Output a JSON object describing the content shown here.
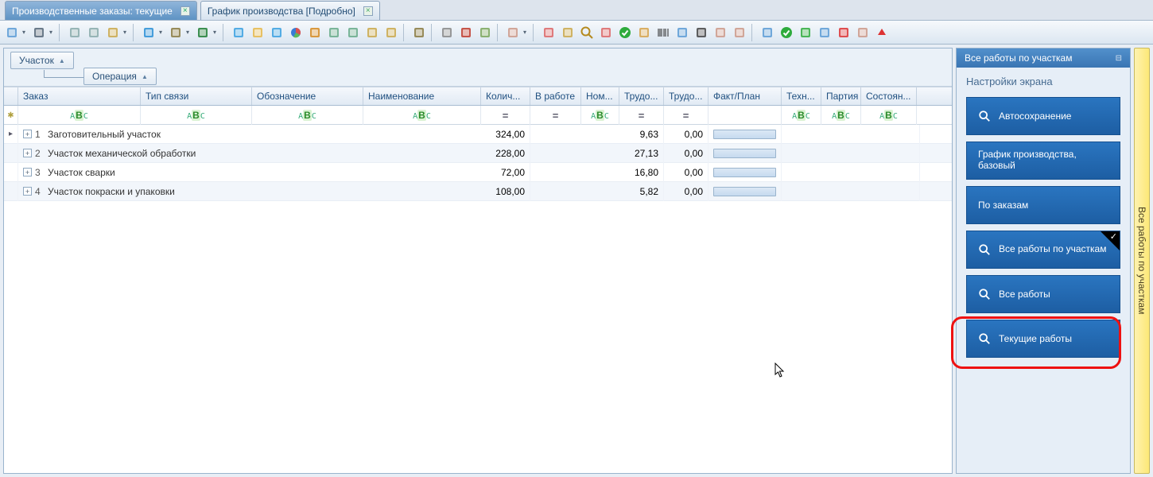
{
  "tabs": [
    {
      "label": "Производственные заказы: текущие",
      "active": true
    },
    {
      "label": "График производства [Подробно]",
      "active": false
    }
  ],
  "toolbar_icons": [
    "clipboard",
    "arrow-down",
    "print",
    "arrow-down",
    "sep",
    "doc-minus",
    "doc-minus2",
    "doc-edit",
    "arrow-down",
    "sep",
    "refresh",
    "arrow-down",
    "wrench",
    "arrow-down",
    "excel",
    "arrow-down",
    "sep",
    "share",
    "note",
    "goto",
    "pie",
    "download",
    "grid1",
    "grid2",
    "calc",
    "book",
    "sep",
    "tool",
    "sep",
    "funnel",
    "tree",
    "clipboard2",
    "sep",
    "magic",
    "arrow-down",
    "sep",
    "cal1",
    "clock",
    "search",
    "cal2",
    "check-green",
    "box",
    "barcode",
    "list-check",
    "binoc",
    "users",
    "hammer",
    "sep",
    "sitemap",
    "ok-green",
    "time-green",
    "grid3",
    "pencil-red",
    "gear",
    "up-red"
  ],
  "groupbar": {
    "g1": "Участок",
    "g2": "Операция"
  },
  "columns": [
    "Заказ",
    "Тип связи",
    "Обозначение",
    "Наименование",
    "Колич...",
    "В работе",
    "Ном...",
    "Трудо...",
    "Трудо...",
    "Факт/План",
    "Техн...",
    "Партия",
    "Состоян..."
  ],
  "filter_types": [
    "abc",
    "abc",
    "abc",
    "abc",
    "eq",
    "eq",
    "",
    "abc",
    "eq",
    "eq",
    "",
    "abc",
    "abc",
    "abc"
  ],
  "rows": [
    {
      "idx": "1",
      "name": "Заготовительный участок",
      "qty": "324,00",
      "lab1": "9,63",
      "lab2": "0,00"
    },
    {
      "idx": "2",
      "name": "Участок механической обработки",
      "qty": "228,00",
      "lab1": "27,13",
      "lab2": "0,00"
    },
    {
      "idx": "3",
      "name": "Участок  сварки",
      "qty": "72,00",
      "lab1": "16,80",
      "lab2": "0,00"
    },
    {
      "idx": "4",
      "name": "Участок покраски и упаковки",
      "qty": "108,00",
      "lab1": "5,82",
      "lab2": "0,00"
    }
  ],
  "right_panel": {
    "title": "Все работы по участкам",
    "subtitle": "Настройки экрана",
    "buttons": [
      {
        "label": "Автосохранение",
        "icon": true,
        "selected": false
      },
      {
        "label": "График производства, базовый",
        "icon": false,
        "selected": false,
        "two": true
      },
      {
        "label": "По заказам",
        "icon": false,
        "selected": false
      },
      {
        "label": "Все работы по участкам",
        "icon": true,
        "selected": true,
        "two": true
      },
      {
        "label": "Все работы",
        "icon": true,
        "selected": false
      },
      {
        "label": "Текущие работы",
        "icon": true,
        "selected": false
      }
    ]
  },
  "vtab_label": "Все работы по участкам"
}
